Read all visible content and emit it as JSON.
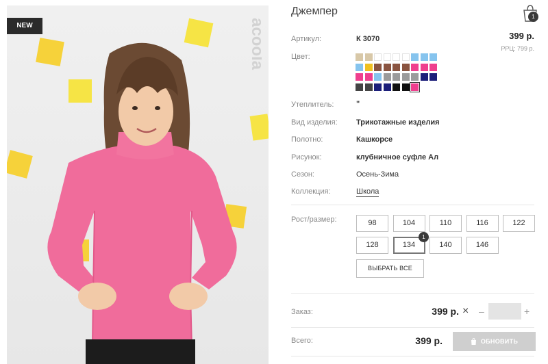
{
  "badge": "NEW",
  "brand": "acoola",
  "product": {
    "title": "Джемпер",
    "cart_count": "1",
    "price": "399 р.",
    "rrp": "РРЦ: 799 р."
  },
  "details": {
    "article_label": "Артикул:",
    "article_value": "К 3070",
    "color_label": "Цвет:",
    "insulation_label": "Утеплитель:",
    "insulation_value": "\"",
    "type_label": "Вид изделия:",
    "type_value": "Трикотажные изделия",
    "fabric_label": "Полотно:",
    "fabric_value": "Кашкорсе",
    "pattern_label": "Рисунок:",
    "pattern_value": "клубничное суфле Ал",
    "season_label": "Сезон:",
    "season_value": "Осень-Зима",
    "collection_label": "Коллекция:",
    "collection_value": "Школа",
    "size_label": "Рост/размер:"
  },
  "colors": [
    [
      "#d8c8a8",
      "#d8c8a8",
      "#ffffff",
      "#ffffff",
      "#ffffff",
      "#ffffff",
      "#86c4ee",
      "#86c4ee",
      "#86c4ee"
    ],
    [
      "#86c4ee",
      "#f0c020",
      "#8a5440",
      "#8a5440",
      "#8a5440",
      "#8a5440",
      "#ef3f8e",
      "#ef3f8e",
      "#ef3f8e"
    ],
    [
      "#ef3f8e",
      "#ef3f8e",
      "#86c4ee",
      "#9b9b9b",
      "#9b9b9b",
      "#9b9b9b",
      "#9b9b9b",
      "#1c1f7a",
      "#1c1f7a"
    ],
    [
      "#444444",
      "#444444",
      "#1c1f7a",
      "#1c1f7a",
      "#111111",
      "#111111",
      "#ef3f8e"
    ]
  ],
  "selected_color": [
    3,
    6
  ],
  "sizes": [
    "98",
    "104",
    "110",
    "116",
    "122",
    "128",
    "134",
    "140",
    "146"
  ],
  "selected_size": "134",
  "selected_size_count": "1",
  "select_all_label": "ВЫБРАТЬ ВСЕ",
  "order": {
    "label": "Заказ:",
    "price": "399 р.",
    "times": "×",
    "minus": "–",
    "plus": "+",
    "qty": ""
  },
  "total": {
    "label": "Всего:",
    "price": "399 р.",
    "update_label": "ОБНОВИТЬ"
  }
}
